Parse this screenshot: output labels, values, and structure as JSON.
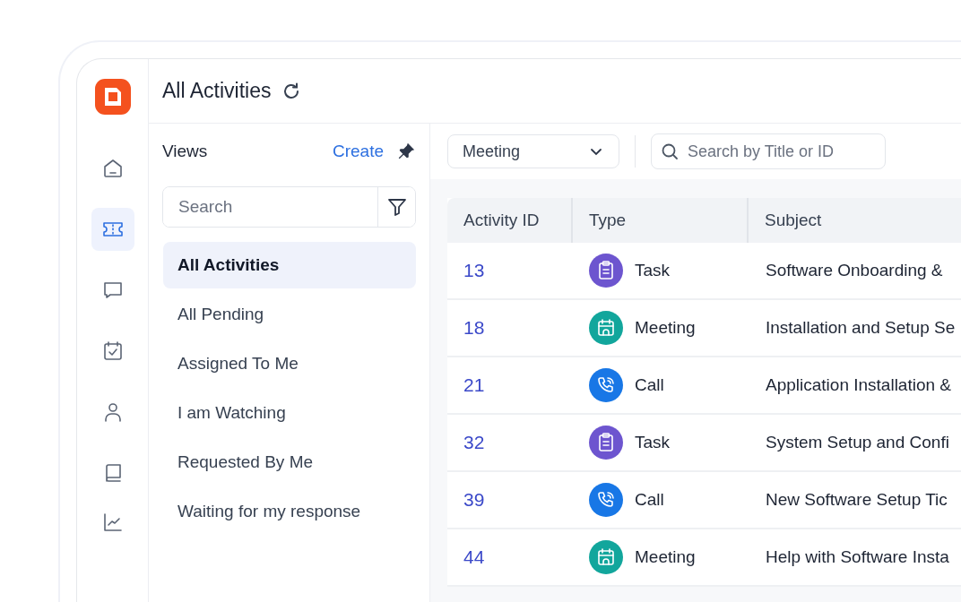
{
  "nav": [
    {
      "kind": "home",
      "selected": false
    },
    {
      "kind": "ticket",
      "selected": true
    },
    {
      "kind": "chat",
      "selected": false
    },
    {
      "kind": "calendar",
      "selected": false
    },
    {
      "kind": "person",
      "selected": false
    },
    {
      "kind": "book",
      "selected": false
    },
    {
      "kind": "chart",
      "selected": false
    }
  ],
  "header": {
    "title": "All Activities"
  },
  "views": {
    "title": "Views",
    "create": "Create",
    "search": {
      "placeholder": "Search"
    },
    "items": [
      {
        "label": "All Activities",
        "selected": true
      },
      {
        "label": "All Pending",
        "selected": false
      },
      {
        "label": "Assigned To Me",
        "selected": false
      },
      {
        "label": "I am Watching",
        "selected": false
      },
      {
        "label": "Requested By Me",
        "selected": false
      },
      {
        "label": "Waiting for my response",
        "selected": false
      }
    ]
  },
  "toolbar": {
    "type_filter": {
      "value": "Meeting"
    },
    "search": {
      "placeholder": "Search by Title or ID"
    }
  },
  "table": {
    "columns": [
      "Activity ID",
      "Type",
      "Subject"
    ],
    "rows": [
      {
        "id": "13",
        "type": "Task",
        "kind": "task",
        "subject": "Software Onboarding &"
      },
      {
        "id": "18",
        "type": "Meeting",
        "kind": "meeting",
        "subject": "Installation and Setup Se"
      },
      {
        "id": "21",
        "type": "Call",
        "kind": "call",
        "subject": "Application Installation &"
      },
      {
        "id": "32",
        "type": "Task",
        "kind": "task",
        "subject": "System Setup and Confi"
      },
      {
        "id": "39",
        "type": "Call",
        "kind": "call",
        "subject": "New Software Setup Tic"
      },
      {
        "id": "44",
        "type": "Meeting",
        "kind": "meeting",
        "subject": "Help with Software Insta"
      }
    ]
  }
}
